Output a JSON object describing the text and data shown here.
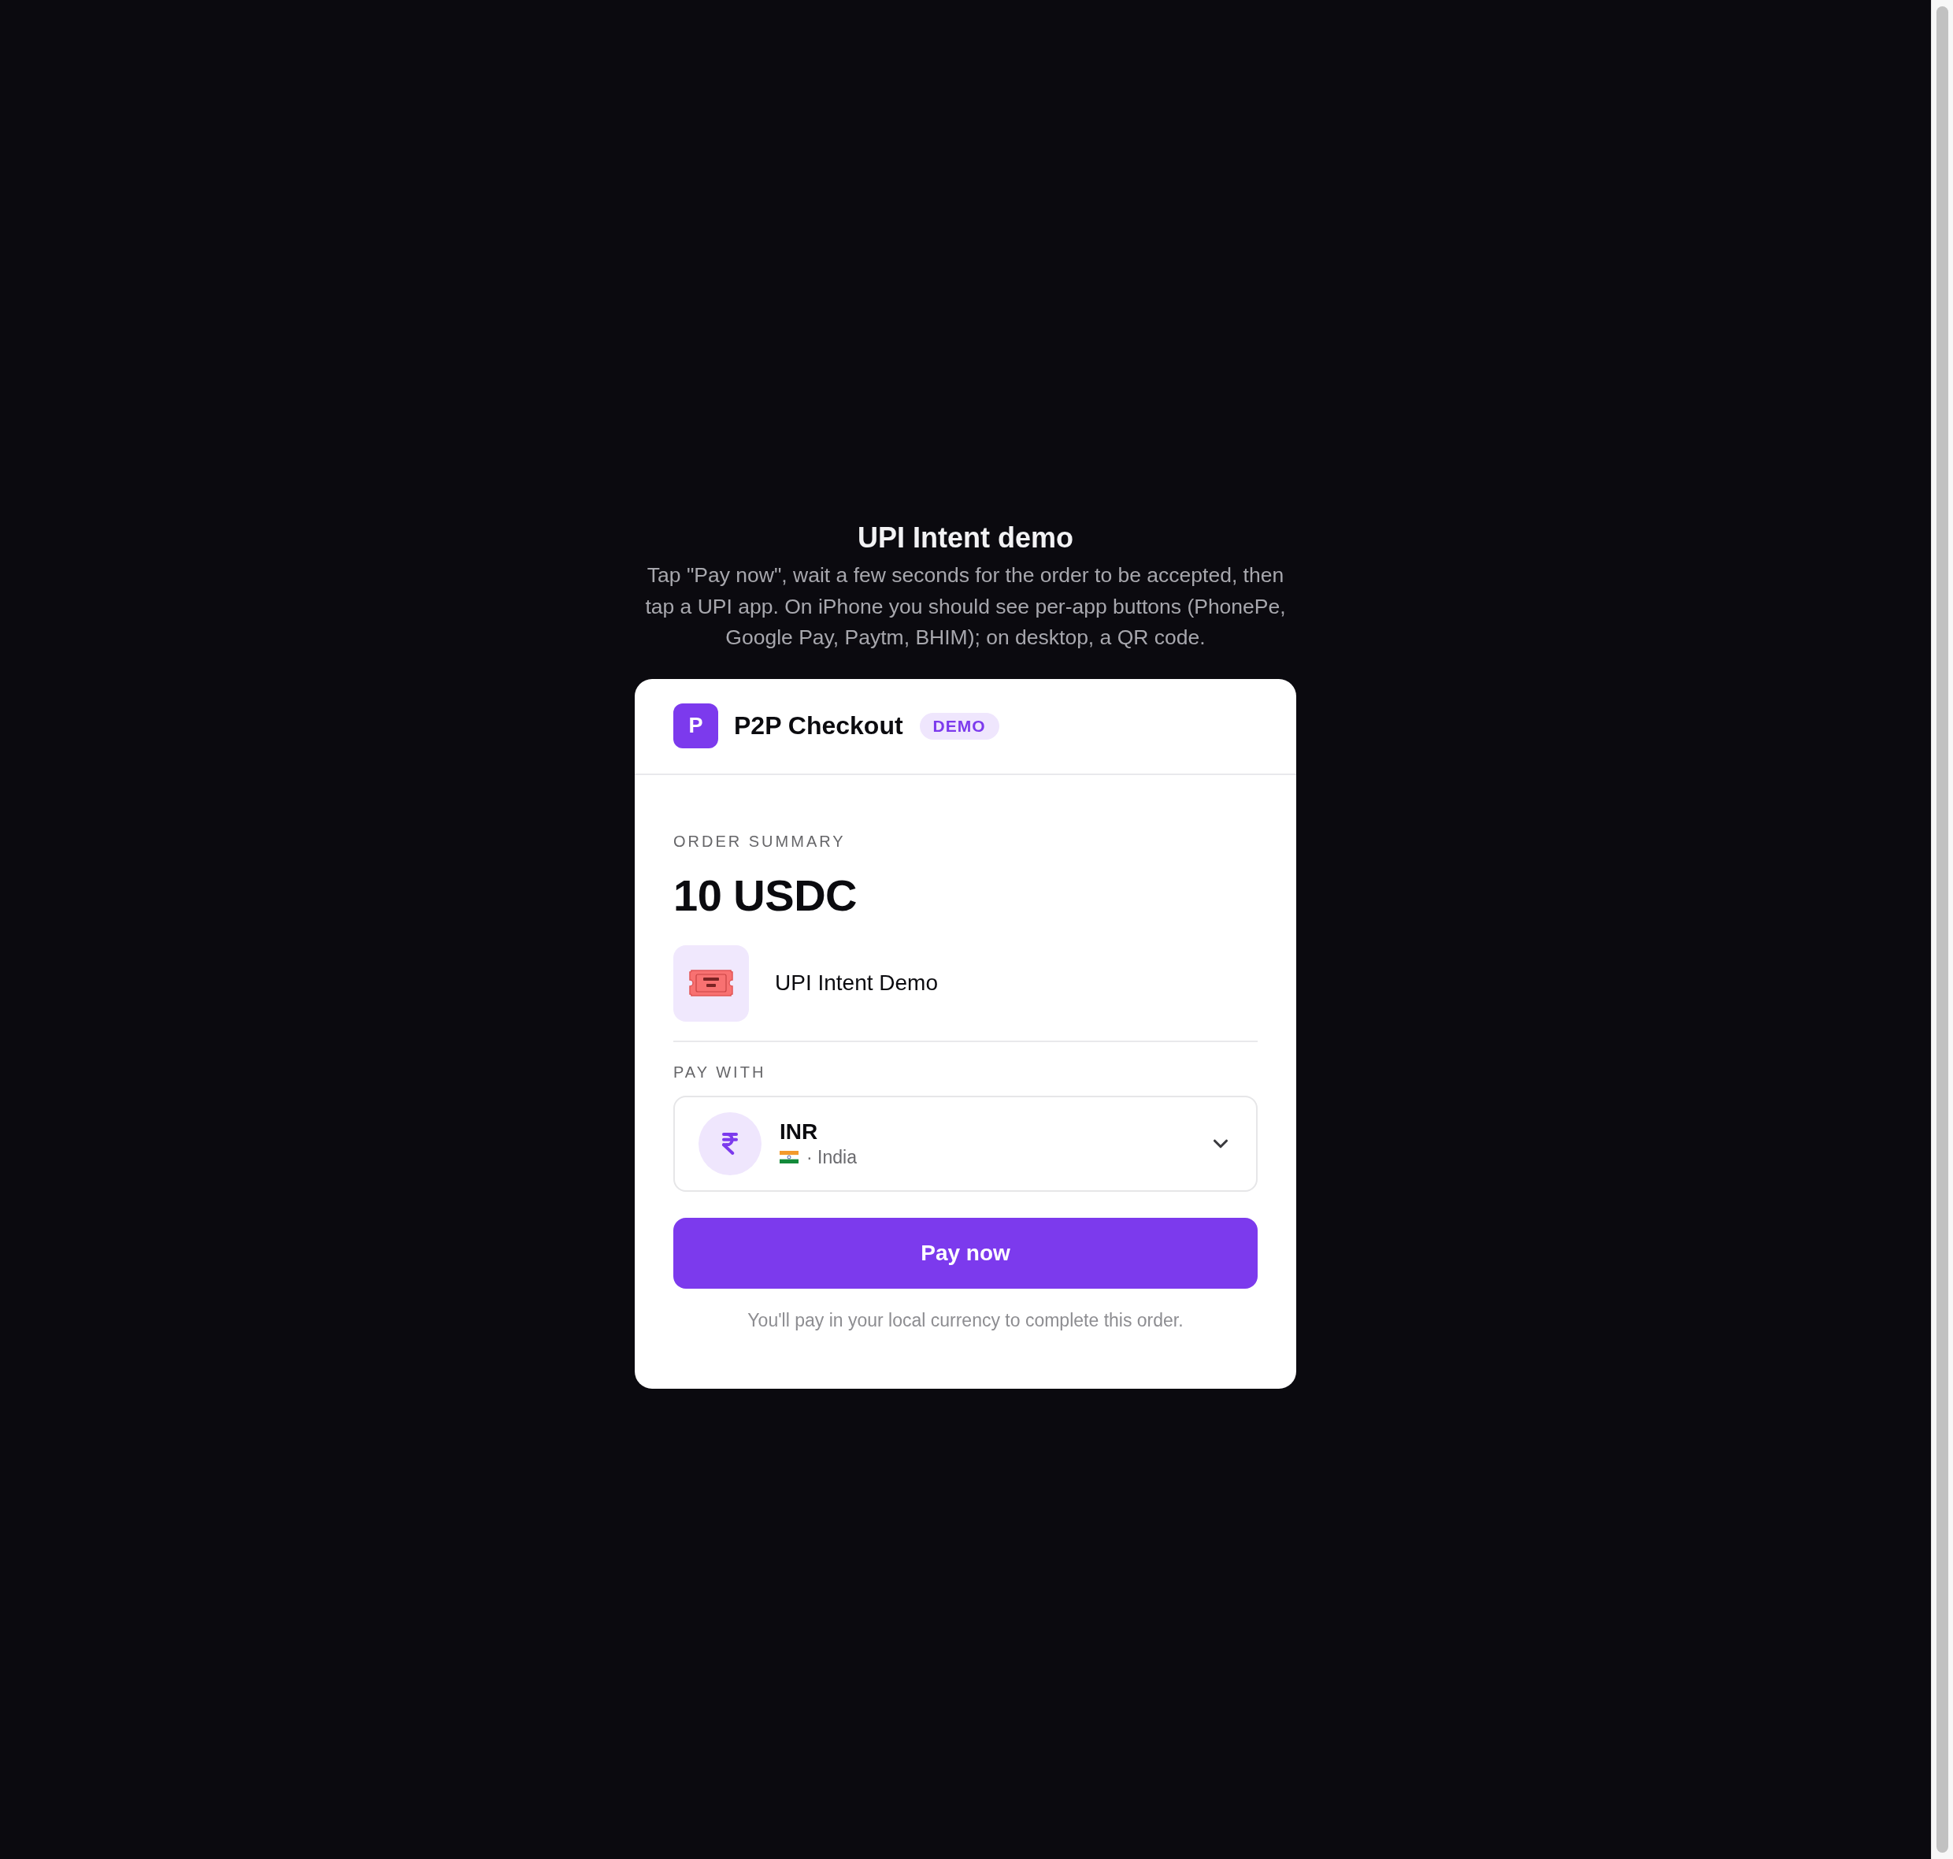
{
  "intro": {
    "title": "UPI Intent demo",
    "description": "Tap \"Pay now\", wait a few seconds for the order to be accepted, then tap a UPI app. On iPhone you should see per-app buttons (PhonePe, Google Pay, Paytm, BHIM); on desktop, a QR code."
  },
  "checkout": {
    "brand": {
      "logo_letter": "P",
      "name": "P2P Checkout",
      "badge": "DEMO"
    },
    "order_summary": {
      "label": "ORDER SUMMARY",
      "amount": "10 USDC",
      "item": {
        "name": "UPI Intent Demo"
      }
    },
    "pay_with": {
      "label": "PAY WITH",
      "currency": {
        "code": "INR",
        "country": "· India"
      }
    },
    "pay_button": {
      "label": "Pay now"
    },
    "footnote": "You'll pay in your local currency to complete this order."
  }
}
